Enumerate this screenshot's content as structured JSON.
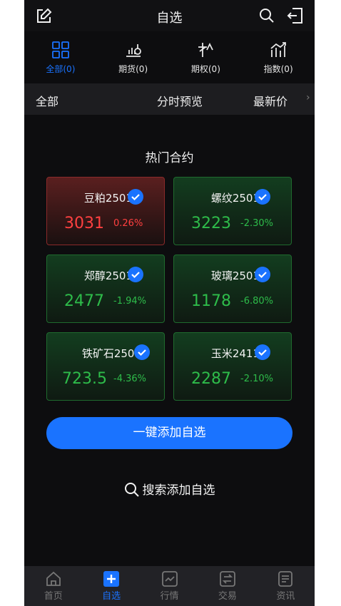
{
  "topbar": {
    "title": "自选",
    "icons": [
      "edit-icon",
      "search-icon",
      "logout-icon"
    ]
  },
  "categories": [
    {
      "label": "全部(0)",
      "icon": "grid-icon",
      "active": true
    },
    {
      "label": "期货(0)",
      "icon": "futures-icon",
      "active": false
    },
    {
      "label": "期权(0)",
      "icon": "options-icon",
      "active": false
    },
    {
      "label": "指数(0)",
      "icon": "index-icon",
      "active": false
    }
  ],
  "header_strip": {
    "col1": "全部",
    "col2": "分时预览",
    "col3": "最新价",
    "chevron": "›"
  },
  "hot": {
    "title": "热门合约",
    "contracts": [
      {
        "name": "豆粕2501",
        "price": "3031",
        "change": "0.26%",
        "direction": "up",
        "checked": true
      },
      {
        "name": "螺纹2501",
        "price": "3223",
        "change": "-2.30%",
        "direction": "down",
        "checked": true
      },
      {
        "name": "郑醇2501",
        "price": "2477",
        "change": "-1.94%",
        "direction": "down",
        "checked": true
      },
      {
        "name": "玻璃2501",
        "price": "1178",
        "change": "-6.80%",
        "direction": "down",
        "checked": true
      },
      {
        "name": "铁矿石2501",
        "price": "723.5",
        "change": "-4.36%",
        "direction": "down",
        "checked": true
      },
      {
        "name": "玉米2411",
        "price": "2287",
        "change": "-2.10%",
        "direction": "down",
        "checked": true
      }
    ]
  },
  "actions": {
    "add_all": "一键添加自选",
    "search_add": "搜索添加自选"
  },
  "tabbar": [
    {
      "label": "首页",
      "icon": "home-icon",
      "active": false
    },
    {
      "label": "自选",
      "icon": "plus-square-icon",
      "active": true
    },
    {
      "label": "行情",
      "icon": "market-chart-icon",
      "active": false
    },
    {
      "label": "交易",
      "icon": "trade-icon",
      "active": false
    },
    {
      "label": "资讯",
      "icon": "news-icon",
      "active": false
    }
  ],
  "colors": {
    "accent": "#1a73ff",
    "up": "#ff4040",
    "down": "#2ebc4a",
    "background": "#0d0d0f"
  }
}
